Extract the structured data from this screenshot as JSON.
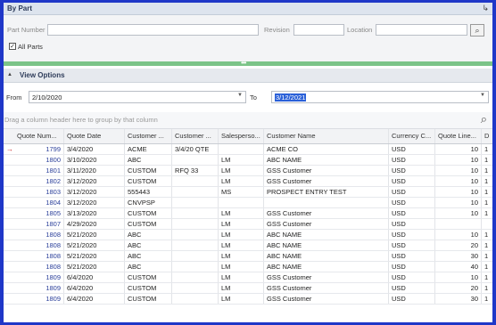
{
  "panel": {
    "title": "By Part",
    "exit_icon": "exit-icon"
  },
  "filters": {
    "part_number_label": "Part Number",
    "revision_label": "Revision",
    "location_label": "Location",
    "all_parts_label": "All Parts",
    "all_parts_checked": true
  },
  "view_options": {
    "title": "View Options"
  },
  "date_range": {
    "from_label": "From",
    "from_value": "2/10/2020",
    "to_label": "To",
    "to_value": "3/12/2021"
  },
  "grid": {
    "group_hint": "Drag a column header here to group by that column",
    "columns": [
      "Quote Num...",
      "Quote Date",
      "Customer ...",
      "Customer ...",
      "Salesperso...",
      "Customer Name",
      "Currency C...",
      "Quote Line...",
      "D"
    ],
    "rows": [
      [
        "1799",
        "3/4/2020",
        "ACME",
        "3/4/20 QTE",
        "",
        "ACME CO",
        "USD",
        "10",
        "1"
      ],
      [
        "1800",
        "3/10/2020",
        "ABC",
        "",
        "LM",
        "ABC NAME",
        "USD",
        "10",
        "1"
      ],
      [
        "1801",
        "3/11/2020",
        "CUSTOM",
        "RFQ 33",
        "LM",
        "GSS Customer",
        "USD",
        "10",
        "1"
      ],
      [
        "1802",
        "3/12/2020",
        "CUSTOM",
        "",
        "LM",
        "GSS Customer",
        "USD",
        "10",
        "1"
      ],
      [
        "1803",
        "3/12/2020",
        "555443",
        "",
        "MS",
        "PROSPECT ENTRY TEST",
        "USD",
        "10",
        "1"
      ],
      [
        "1804",
        "3/12/2020",
        "CNVPSP",
        "",
        "",
        "",
        "USD",
        "10",
        "1"
      ],
      [
        "1805",
        "3/13/2020",
        "CUSTOM",
        "",
        "LM",
        "GSS Customer",
        "USD",
        "10",
        "1"
      ],
      [
        "1807",
        "4/29/2020",
        "CUSTOM",
        "",
        "LM",
        "GSS Customer",
        "USD",
        "",
        ""
      ],
      [
        "1808",
        "5/21/2020",
        "ABC",
        "",
        "LM",
        "ABC NAME",
        "USD",
        "10",
        "1"
      ],
      [
        "1808",
        "5/21/2020",
        "ABC",
        "",
        "LM",
        "ABC NAME",
        "USD",
        "20",
        "1"
      ],
      [
        "1808",
        "5/21/2020",
        "ABC",
        "",
        "LM",
        "ABC NAME",
        "USD",
        "30",
        "1"
      ],
      [
        "1808",
        "5/21/2020",
        "ABC",
        "",
        "LM",
        "ABC NAME",
        "USD",
        "40",
        "1"
      ],
      [
        "1809",
        "6/4/2020",
        "CUSTOM",
        "",
        "LM",
        "GSS Customer",
        "USD",
        "10",
        "1"
      ],
      [
        "1809",
        "6/4/2020",
        "CUSTOM",
        "",
        "LM",
        "GSS Customer",
        "USD",
        "20",
        "1"
      ],
      [
        "1809",
        "6/4/2020",
        "CUSTOM",
        "",
        "LM",
        "GSS Customer",
        "USD",
        "30",
        "1"
      ]
    ]
  }
}
